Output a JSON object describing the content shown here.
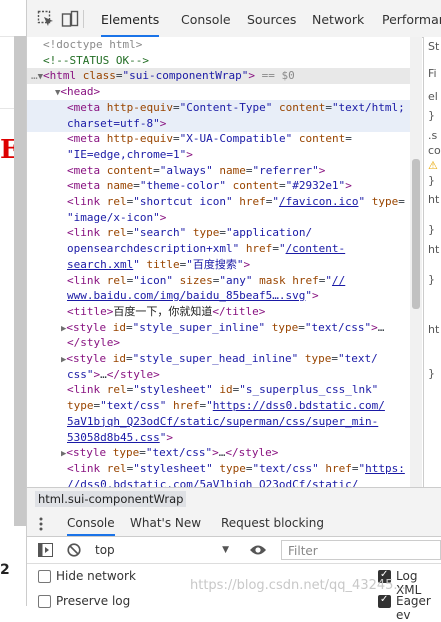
{
  "toolbar": {
    "tabs": [
      "Elements",
      "Console",
      "Sources",
      "Network",
      "Performanc"
    ]
  },
  "code_lines": [
    {
      "indent": 0,
      "html": "<span class=\"dt\">&lt;!doctype html&gt;</span>"
    },
    {
      "indent": 0,
      "html": "<span class=\"cm\">&lt;!--STATUS OK--&gt;</span>"
    },
    {
      "indent": 0,
      "sel": true,
      "html": "<span class=\"dt\">…</span><span class=\"arrow\">▼</span><span class=\"tag\">&lt;html</span> <span class=\"an\">class</span>=<span class=\"av\">\"sui-componentWrap\"</span><span class=\"tag\">&gt;</span> <span class=\"dt\">== $0</span>"
    },
    {
      "indent": 1,
      "html": "<span class=\"arrow\">▼</span><span class=\"tag\">&lt;head&gt;</span>"
    },
    {
      "indent": 2,
      "hl": true,
      "html": "<span class=\"tag\">&lt;meta</span> <span class=\"an\">http-equiv</span>=<span class=\"av\">\"Content-Type\"</span> <span class=\"an\">content</span>=<span class=\"av\">\"text/html;</span>"
    },
    {
      "indent": 2,
      "hl": true,
      "html": "<span class=\"av\">charset=utf-8\"</span><span class=\"tag\">&gt;</span>"
    },
    {
      "indent": 2,
      "html": "<span class=\"tag\">&lt;meta</span> <span class=\"an\">http-equiv</span>=<span class=\"av\">\"X-UA-Compatible\"</span> <span class=\"an\">content</span>="
    },
    {
      "indent": 2,
      "html": "<span class=\"av\">\"IE=edge,chrome=1\"</span><span class=\"tag\">&gt;</span>"
    },
    {
      "indent": 2,
      "html": "<span class=\"tag\">&lt;meta</span> <span class=\"an\">content</span>=<span class=\"av\">\"always\"</span> <span class=\"an\">name</span>=<span class=\"av\">\"referrer\"</span><span class=\"tag\">&gt;</span>"
    },
    {
      "indent": 2,
      "html": "<span class=\"tag\">&lt;meta</span> <span class=\"an\">name</span>=<span class=\"av\">\"theme-color\"</span> <span class=\"an\">content</span>=<span class=\"av\">\"#2932e1\"</span><span class=\"tag\">&gt;</span>"
    },
    {
      "indent": 2,
      "html": "<span class=\"tag\">&lt;link</span> <span class=\"an\">rel</span>=<span class=\"av\">\"shortcut icon\"</span> <span class=\"an\">href</span>=<span class=\"av\">\"</span><span class=\"av link\">/favicon.ico</span><span class=\"av\">\"</span> <span class=\"an\">type</span>="
    },
    {
      "indent": 2,
      "html": "<span class=\"av\">\"image/x-icon\"</span><span class=\"tag\">&gt;</span>"
    },
    {
      "indent": 2,
      "html": "<span class=\"tag\">&lt;link</span> <span class=\"an\">rel</span>=<span class=\"av\">\"search\"</span> <span class=\"an\">type</span>=<span class=\"av\">\"application/</span>"
    },
    {
      "indent": 2,
      "html": "<span class=\"av\">opensearchdescription+xml\"</span> <span class=\"an\">href</span>=<span class=\"av\">\"</span><span class=\"av link\">/content-</span>"
    },
    {
      "indent": 2,
      "html": "<span class=\"av link\">search.xml</span><span class=\"av\">\"</span> <span class=\"an\">title</span>=<span class=\"av\">\"百度搜索\"</span><span class=\"tag\">&gt;</span>"
    },
    {
      "indent": 2,
      "html": "<span class=\"tag\">&lt;link</span> <span class=\"an\">rel</span>=<span class=\"av\">\"icon\"</span> <span class=\"an\">sizes</span>=<span class=\"av\">\"any\"</span> <span class=\"an\">mask</span> <span class=\"an\">href</span>=<span class=\"av\">\"</span><span class=\"av link\">//</span>"
    },
    {
      "indent": 2,
      "html": "<span class=\"av link\">www.baidu.com/img/baidu_85beaf5….svg</span><span class=\"av\">\"</span><span class=\"tag\">&gt;</span>"
    },
    {
      "indent": 2,
      "html": "<span class=\"tag\">&lt;title&gt;</span><span class=\"tx\">百度一下，你就知道</span><span class=\"tag\">&lt;/title&gt;</span>"
    },
    {
      "indent": 1.5,
      "html": "<span class=\"arrow\">▶</span><span class=\"tag\">&lt;style</span> <span class=\"an\">id</span>=<span class=\"av\">\"style_super_inline\"</span> <span class=\"an\">type</span>=<span class=\"av\">\"text/css\"</span><span class=\"tag\">&gt;</span>…"
    },
    {
      "indent": 2,
      "html": "<span class=\"tag\">&lt;/style&gt;</span>"
    },
    {
      "indent": 1.5,
      "html": "<span class=\"arrow\">▶</span><span class=\"tag\">&lt;style</span> <span class=\"an\">id</span>=<span class=\"av\">\"style_super_head_inline\"</span> <span class=\"an\">type</span>=<span class=\"av\">\"text/</span>"
    },
    {
      "indent": 2,
      "html": "<span class=\"av\">css\"</span><span class=\"tag\">&gt;</span>…<span class=\"tag\">&lt;/style&gt;</span>"
    },
    {
      "indent": 2,
      "html": "<span class=\"tag\">&lt;link</span> <span class=\"an\">rel</span>=<span class=\"av\">\"stylesheet\"</span> <span class=\"an\">id</span>=<span class=\"av\">\"s_superplus_css_lnk\"</span>"
    },
    {
      "indent": 2,
      "html": "<span class=\"an\">type</span>=<span class=\"av\">\"text/css\"</span> <span class=\"an\">href</span>=<span class=\"av\">\"</span><span class=\"av link\">https://dss0.bdstatic.com/</span>"
    },
    {
      "indent": 2,
      "html": "<span class=\"av link\">5aV1bjqh_Q23odCf/static/superman/css/super_min-</span>"
    },
    {
      "indent": 2,
      "html": "<span class=\"av link\">53058d8b45.css</span><span class=\"av\">\"</span><span class=\"tag\">&gt;</span>"
    },
    {
      "indent": 1.5,
      "html": "<span class=\"arrow\">▶</span><span class=\"tag\">&lt;style</span> <span class=\"an\">type</span>=<span class=\"av\">\"text/css\"</span><span class=\"tag\">&gt;</span>…<span class=\"tag\">&lt;/style&gt;</span>"
    },
    {
      "indent": 2,
      "html": "<span class=\"tag\">&lt;link</span> <span class=\"an\">rel</span>=<span class=\"av\">\"stylesheet\"</span> <span class=\"an\">type</span>=<span class=\"av\">\"text/css\"</span> <span class=\"an\">href</span>=<span class=\"av\">\"</span><span class=\"av link\">https:</span>"
    },
    {
      "indent": 2,
      "html": "<span class=\"av link\">//dss0.bdstatic.com/5aV1bjqh_Q23odCf/static/</span>"
    }
  ],
  "sidebar_texts": [
    "St",
    "Fi",
    "el",
    "}",
    ".s",
    "co",
    "⚠",
    "}",
    "ht",
    "}",
    "ht",
    "}",
    "ht",
    "}"
  ],
  "breadcrumb": "html.sui-componentWrap",
  "drawer": {
    "tabs": [
      "Console",
      "What's New",
      "Request blocking"
    ]
  },
  "console": {
    "context": "top",
    "filter_placeholder": "Filter"
  },
  "options": {
    "hide_network": "Hide network",
    "preserve_log": "Preserve log",
    "log_xml": "Log XML",
    "eager_eval": "Eager ev"
  },
  "page_fragments": {
    "red_text": "E",
    "number": "2"
  },
  "watermark": "https://blog.csdn.net/qq_43245..."
}
